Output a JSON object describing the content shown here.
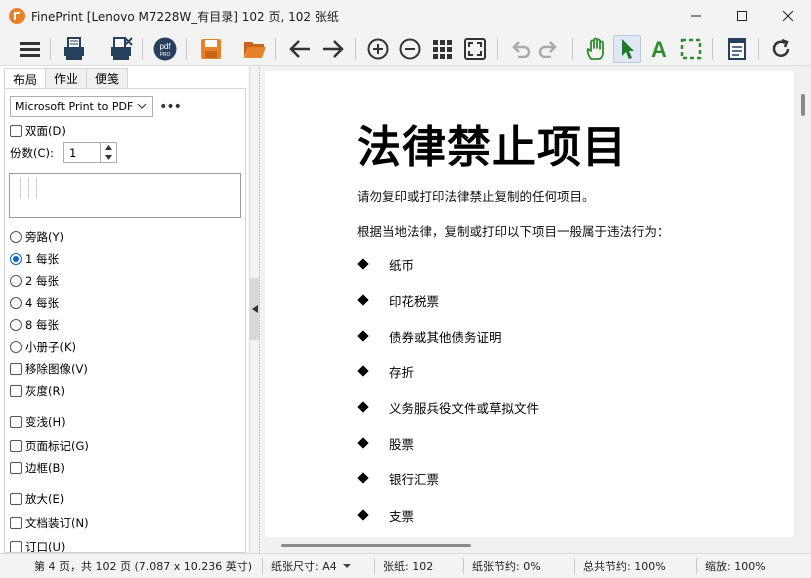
{
  "window": {
    "title": "FinePrint [Lenovo M7228W_有目录] 102 页, 102 张纸",
    "minimize_glyph": "—",
    "maximize_glyph": "☐",
    "close_glyph": "✕"
  },
  "toolbar": {
    "buttons": [
      {
        "name": "menu-icon"
      },
      {
        "name": "print-icon"
      },
      {
        "name": "print-delete-icon"
      },
      {
        "name": "pdf-factory-pro-icon"
      },
      {
        "name": "save-icon"
      },
      {
        "name": "open-folder-icon"
      },
      {
        "name": "back-arrow-icon"
      },
      {
        "name": "forward-arrow-icon"
      },
      {
        "name": "zoom-in-icon"
      },
      {
        "name": "zoom-out-icon"
      },
      {
        "name": "thumbnails-grid-icon"
      },
      {
        "name": "fit-page-icon"
      },
      {
        "name": "undo-icon"
      },
      {
        "name": "redo-icon"
      },
      {
        "name": "hand-pan-icon"
      },
      {
        "name": "select-arrow-icon"
      },
      {
        "name": "text-tool-icon"
      },
      {
        "name": "marquee-select-icon"
      },
      {
        "name": "form-notes-icon"
      },
      {
        "name": "refresh-icon"
      }
    ],
    "pdf_badge_line1": "pdf",
    "pdf_badge_line2": "PRO",
    "text_tool_letter": "A"
  },
  "left_panel": {
    "tabs": [
      "布局",
      "作业",
      "便笺"
    ],
    "printer": "Microsoft Print to PDF",
    "more_label": "•••",
    "duplex_label": "双面(D)",
    "copies_label": "份数(C):",
    "copies_value": "1",
    "layout_options": [
      {
        "label": "旁路(Y)",
        "checked": false
      },
      {
        "label": "1 每张",
        "checked": true
      },
      {
        "label": "2 每张",
        "checked": false
      },
      {
        "label": "4 每张",
        "checked": false
      },
      {
        "label": "8 每张",
        "checked": false
      },
      {
        "label": "小册子(K)",
        "checked": false
      }
    ],
    "checkboxes_a": [
      "移除图像(V)",
      "灰度(R)"
    ],
    "checkboxes_b": [
      "变浅(H)",
      "页面标记(G)",
      "边框(B)"
    ],
    "checkboxes_c": [
      "放大(E)",
      "文档装订(N)",
      "订口(U)"
    ]
  },
  "document": {
    "title": "法律禁止项目",
    "intro": "请勿复印或打印法律禁止复制的任何项目。",
    "lead": "根据当地法律，复制或打印以下项目一般属于违法行为：",
    "items": [
      "纸币",
      "印花税票",
      "债券或其他债务证明",
      "存折",
      "义务服兵役文件或草拟文件",
      "股票",
      "银行汇票",
      "支票"
    ]
  },
  "statusbar": {
    "page_info": "第 4 页，共 102 页 (7.087 x 10.236 英寸)",
    "paper_size": "纸张尺寸: A4",
    "sheets": "张纸:   102",
    "paper_saved": "纸张节约:   0%",
    "total_saved": "总共节约:   100%",
    "zoom": "缩放:   100%"
  },
  "colors": {
    "accent": "#0a64c6",
    "save_orange": "#e8822a",
    "hand_green": "#2e8b2e"
  }
}
